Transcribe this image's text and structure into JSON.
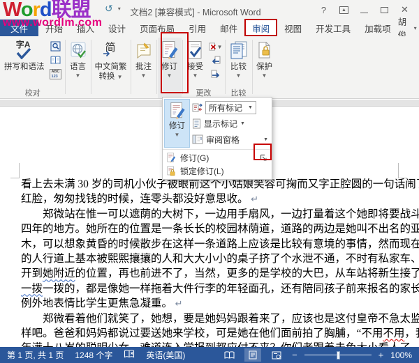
{
  "titlebar": {
    "title": "文档2 [兼容模式] - Microsoft Word",
    "help": "?"
  },
  "quick_access": {
    "undo": "↺",
    "dropdown": "▾"
  },
  "watermark": {
    "letters": [
      {
        "ch": "W",
        "color": "#cf2030"
      },
      {
        "ch": "o",
        "color": "#1f9d2c"
      },
      {
        "ch": "r",
        "color": "#f5a300"
      },
      {
        "ch": "d",
        "color": "#2050c8"
      },
      {
        "ch": "联",
        "color": "#9b30c8"
      },
      {
        "ch": "盟",
        "color": "#9b30c8"
      }
    ],
    "url": "www.wordlm.com",
    "url_color": "#e6007e"
  },
  "tabs": [
    {
      "label": "文件",
      "type": "file"
    },
    {
      "label": "开始"
    },
    {
      "label": "插入"
    },
    {
      "label": "设计"
    },
    {
      "label": "页面布局"
    },
    {
      "label": "引用"
    },
    {
      "label": "邮件"
    },
    {
      "label": "审阅",
      "active": true,
      "annotated": true
    },
    {
      "label": "视图"
    },
    {
      "label": "开发工具"
    },
    {
      "label": "加载项"
    }
  ],
  "account": {
    "name": "胡俊"
  },
  "ribbon": {
    "spelling": "拼写和语法",
    "spelling_glyph": "字A",
    "proofing_label": "校对",
    "wordcount_abc": "ABC",
    "wordcount_123": "123",
    "language": "语言",
    "convert_line1": "中文简繁",
    "convert_line2": "转换",
    "comments": "批注",
    "track": "修订",
    "accept": "接受",
    "changes_label": "更改",
    "compare": "比较",
    "compare_label": "比较",
    "protect": "保护"
  },
  "popup": {
    "track_big": "修订",
    "all_markup": "所有标记",
    "show_markup": "显示标记",
    "reviewing_pane": "审阅窗格",
    "menu_track": "修订(G)",
    "menu_lock": "锁定修订(L)"
  },
  "document": {
    "lines": [
      {
        "segments": [
          {
            "t": "看上去未满 30 岁的司机小伙子被眼前这个小姑娘笑容可掬而又字正腔圆的一句话闹了个大"
          }
        ]
      },
      {
        "end": true,
        "segments": [
          {
            "t": "红脸，匆匆找钱的时候，连零头都没好意思收。"
          },
          {
            "t": " ↵",
            "u": "mark"
          }
        ]
      },
      {
        "indent": true,
        "segments": [
          {
            "t": "郑微站在惟一可以遮荫的大树下，一边用手扇风，一边打量着这个她即将要战斗和生活"
          }
        ]
      },
      {
        "segments": [
          {
            "t": "四年的地方。她所在的位置是一条长长的校园林荫道，道路的两边是她叫不出名的亚热带树"
          }
        ]
      },
      {
        "segments": [
          {
            "t": "木，可以想象黄昏的时候散步在这样一条道路上应该是比较有意境的事情，然而现在整条路"
          }
        ]
      },
      {
        "segments": [
          {
            "t": "的人行道上基本被熙熙攘攘的人和大大小小的桌子挤了个水泄不通，不时有私家车、出租车"
          }
        ]
      },
      {
        "segments": [
          {
            "t": "开到"
          },
          {
            "t": "她附近",
            "u": "blue"
          },
          {
            "t": "的位置，再也前进不了，当然，更多的是学校的大巴，从车站将新生接了过来，"
          }
        ]
      },
      {
        "segments": [
          {
            "t": "一拨",
            "u": "blue"
          },
          {
            "t": "一拨的，都是像她一样拖着大件行李的年轻面孔，还有陪同孩子前来报名的家长，无一"
          }
        ]
      },
      {
        "end": true,
        "segments": [
          {
            "t": "例外地表情比学生更焦急凝重。"
          },
          {
            "t": " ↵",
            "u": "mark"
          }
        ]
      },
      {
        "indent": true,
        "segments": [
          {
            "t": "郑微看着他们就笑了，她想，要是她妈妈跟着来了，应该也是这付皇帝不急太监急的模"
          }
        ]
      },
      {
        "segments": [
          {
            "t": "样吧。爸爸和妈妈都说过要送她来学校，可是她在他们面前拍了胸脯，“不用"
          },
          {
            "t": "不用",
            "u": "red"
          },
          {
            "t": "，我一个"
          }
        ]
      },
      {
        "segments": [
          {
            "t": "年满十八岁的聪明少女，难道连入学报到都应付不来？你们老跟着未免太小看人了，别忘了"
          }
        ]
      }
    ]
  },
  "status": {
    "page": "第 1 页, 共 1 页",
    "words": "1248 个字",
    "language": "英语(美国)",
    "zoom": "100%",
    "zoom_minus": "−",
    "zoom_plus": "+"
  }
}
